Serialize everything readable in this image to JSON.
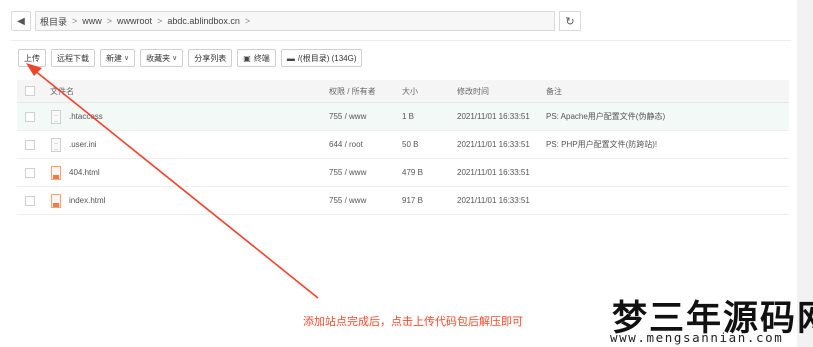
{
  "breadcrumb": {
    "items": [
      "根目录",
      "www",
      "wwwroot",
      "abdc.ablindbox.cn"
    ],
    "separator": ">"
  },
  "toolbar": {
    "upload": "上传",
    "remote_download": "远程下载",
    "new": "新建",
    "favorites": "收藏夹",
    "share_list": "分享列表",
    "terminal": "终端",
    "disk": "/(根目录) (134G)"
  },
  "table": {
    "headers": {
      "name": "文件名",
      "perm": "权限 / 所有者",
      "size": "大小",
      "mtime": "修改时间",
      "note": "备注"
    },
    "rows": [
      {
        "name": ".htaccess",
        "perm": "755 / www",
        "size": "1 B",
        "mtime": "2021/11/01 16:33:51",
        "note": "PS: Apache用户配置文件(伪静态)",
        "icon": "file-icon"
      },
      {
        "name": ".user.ini",
        "perm": "644 / root",
        "size": "50 B",
        "mtime": "2021/11/01 16:33:51",
        "note": "PS: PHP用户配置文件(防跨站)!",
        "icon": "file-icon"
      },
      {
        "name": "404.html",
        "perm": "755 / www",
        "size": "479 B",
        "mtime": "2021/11/01 16:33:51",
        "note": "",
        "icon": "html-file-icon"
      },
      {
        "name": "index.html",
        "perm": "755 / www",
        "size": "917 B",
        "mtime": "2021/11/01 16:33:51",
        "note": "",
        "icon": "html-file-icon"
      }
    ]
  },
  "annotation": {
    "caption": "添加站点完成后，点击上传代码包后解压即可",
    "arrow_color": "#f0442a"
  },
  "watermark": {
    "title": "梦三年源码网",
    "url": "www.mengsannian.com"
  }
}
